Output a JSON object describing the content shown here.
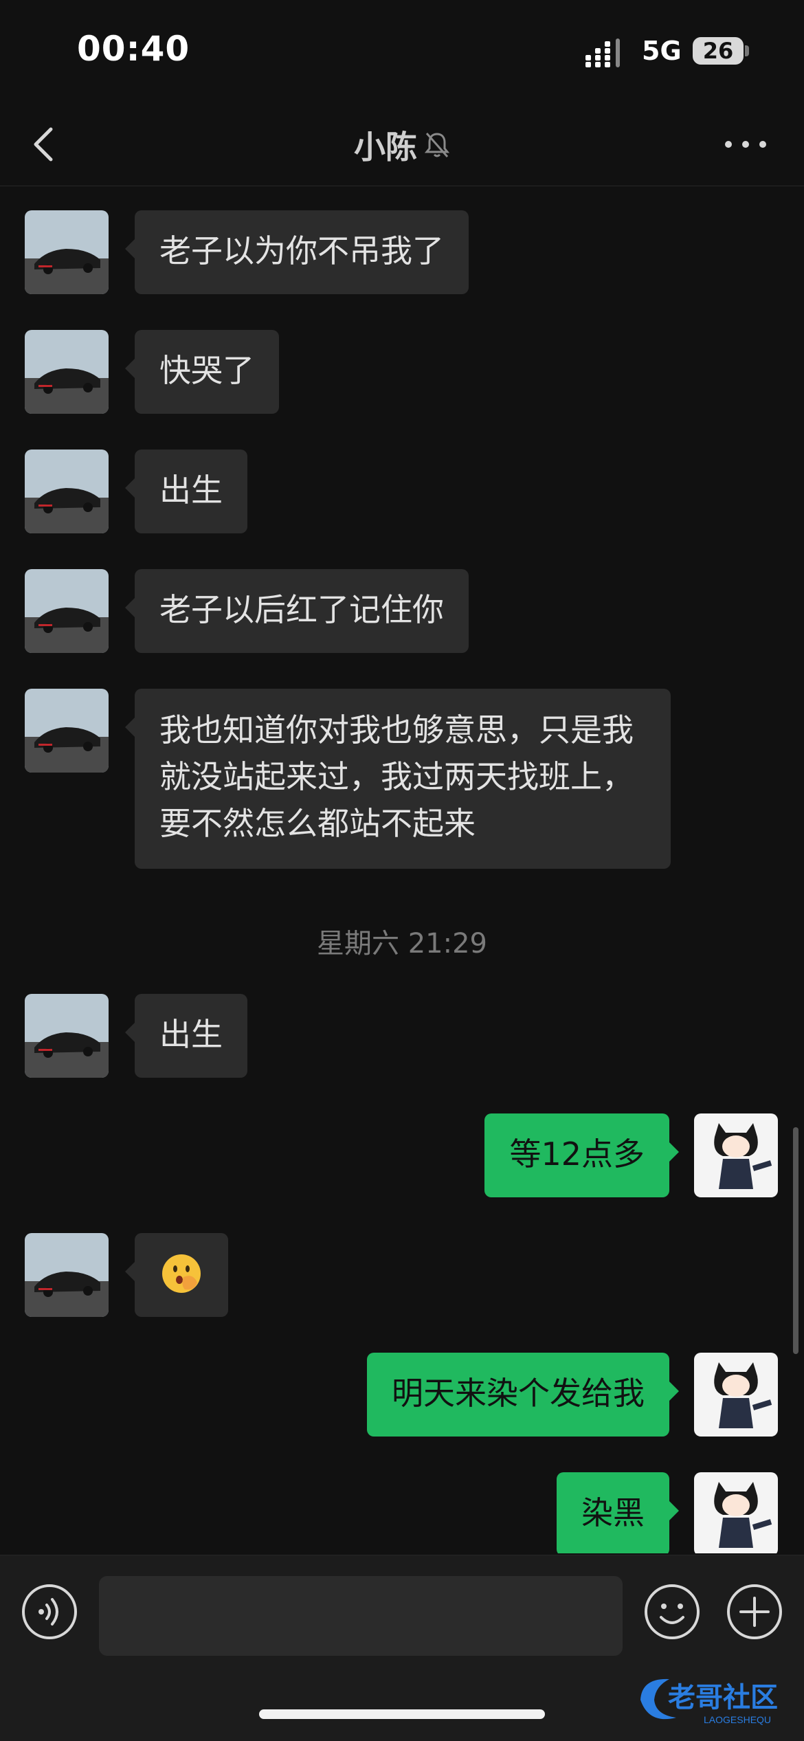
{
  "status_bar": {
    "time": "00:40",
    "network": "5G",
    "battery": "26"
  },
  "nav": {
    "title": "小陈",
    "mute_icon": "bell-slash-icon"
  },
  "messages": [
    {
      "side": "in",
      "text": "老子以为你不吊我了"
    },
    {
      "side": "in",
      "text": "快哭了"
    },
    {
      "side": "in",
      "text": "出生"
    },
    {
      "side": "in",
      "text": "老子以后红了记住你"
    },
    {
      "side": "in",
      "text": "我也知道你对我也够意思，只是我就没站起来过，我过两天找班上，要不然怎么都站不起来"
    },
    {
      "type": "timestamp",
      "text": "星期六 21:29"
    },
    {
      "side": "in",
      "text": "出生"
    },
    {
      "side": "out",
      "text": "等12点多"
    },
    {
      "side": "in",
      "text": "🫢",
      "emoji_name": "face-with-hand-over-mouth"
    },
    {
      "side": "out",
      "text": "明天来染个发给我"
    },
    {
      "side": "out",
      "text": "染黑"
    }
  ],
  "input": {
    "value": "",
    "placeholder": ""
  },
  "watermark": {
    "text": "老哥社区",
    "subtext": "LAOGESHEQU"
  },
  "colors": {
    "background": "#111111",
    "incoming_bubble": "#2c2c2c",
    "outgoing_bubble": "#20b95f",
    "timestamp": "#7a7a7a"
  }
}
